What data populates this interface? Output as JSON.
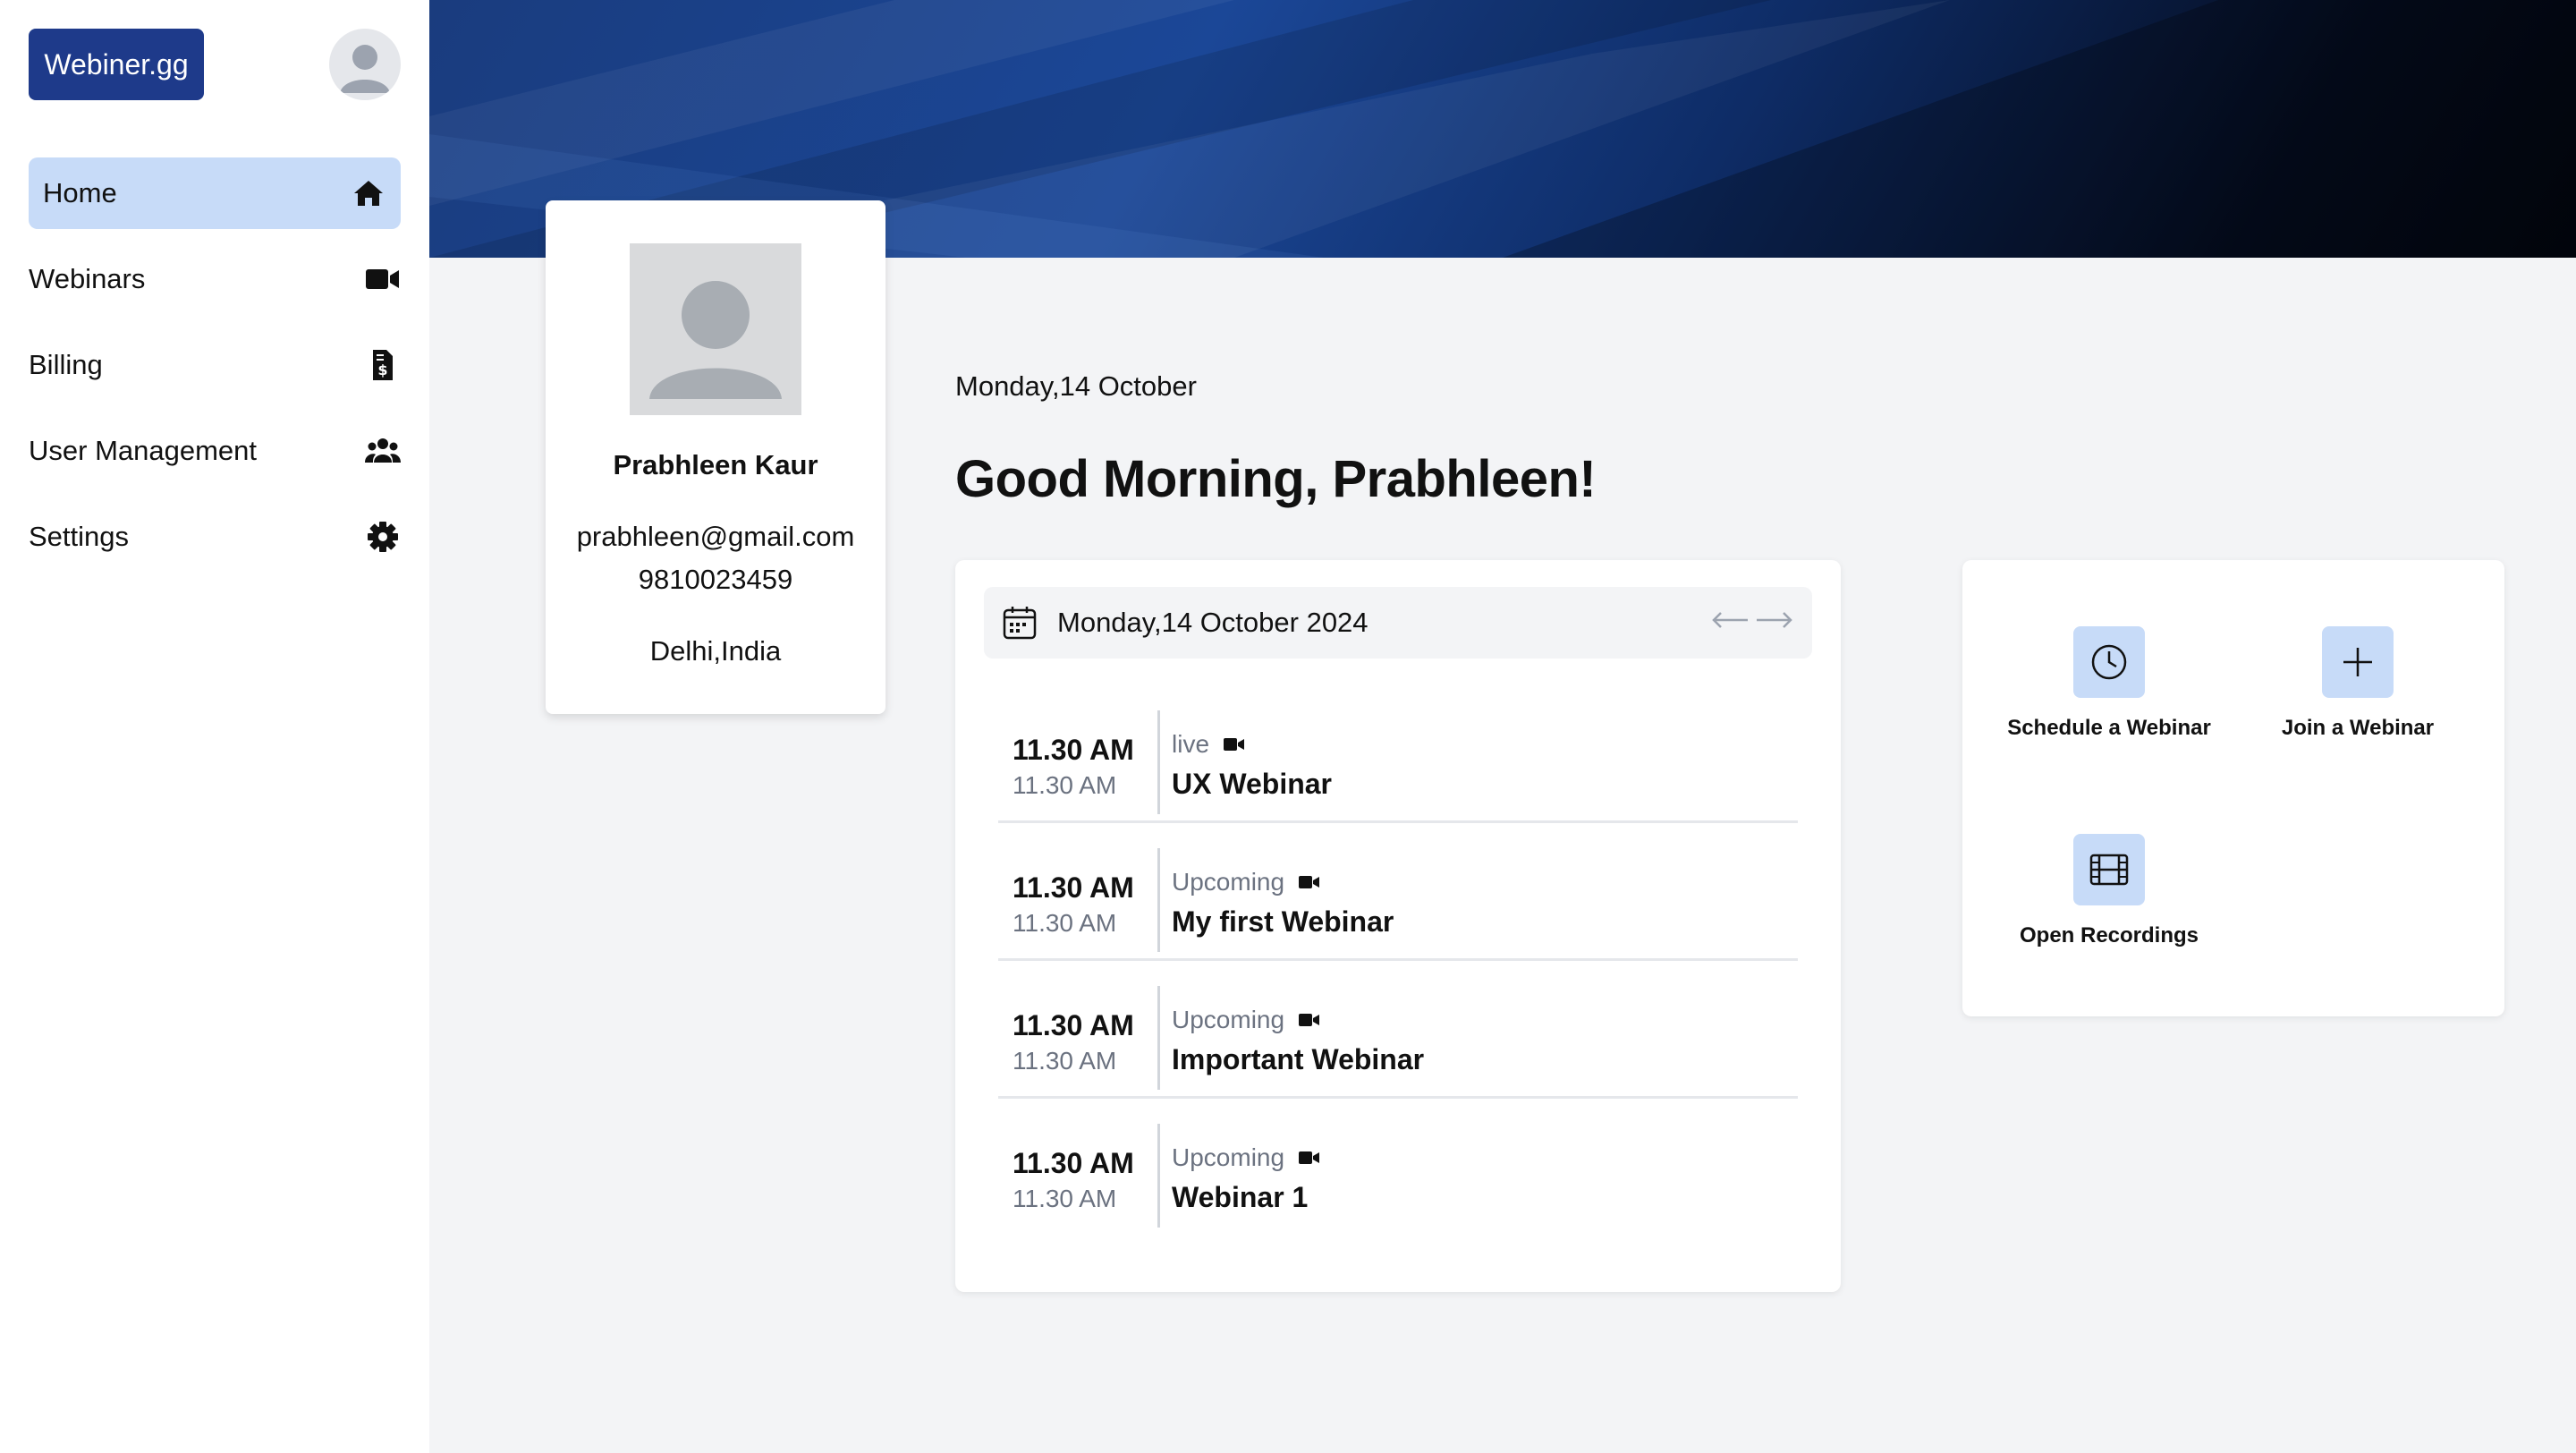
{
  "sidebar": {
    "logo": "Webiner.gg",
    "items": [
      {
        "label": "Home",
        "icon": "home-icon",
        "active": true
      },
      {
        "label": "Webinars",
        "icon": "video-camera-icon"
      },
      {
        "label": "Billing",
        "icon": "invoice-dollar-icon"
      },
      {
        "label": "User Management",
        "icon": "users-icon"
      },
      {
        "label": "Settings",
        "icon": "gear-icon"
      }
    ]
  },
  "profile": {
    "name": "Prabhleen Kaur",
    "email": "prabhleen@gmail.com",
    "phone": "9810023459",
    "location": "Delhi,India"
  },
  "greeting": {
    "date": "Monday,14 October",
    "message": "Good Morning, Prabhleen!"
  },
  "schedule": {
    "header_date": "Monday,14 October 2024",
    "items": [
      {
        "start": "11.30 AM",
        "end": "11.30 AM",
        "status": "live",
        "title": "UX Webinar"
      },
      {
        "start": "11.30 AM",
        "end": "11.30 AM",
        "status": "Upcoming",
        "title": "My first Webinar"
      },
      {
        "start": "11.30 AM",
        "end": "11.30 AM",
        "status": "Upcoming",
        "title": "Important Webinar"
      },
      {
        "start": "11.30 AM",
        "end": "11.30 AM",
        "status": "Upcoming",
        "title": "Webinar 1"
      }
    ]
  },
  "actions": {
    "schedule": "Schedule a Webinar",
    "join": "Join a Webinar",
    "recordings": "Open Recordings"
  },
  "colors": {
    "brand": "#1e3a8a",
    "accent_light": "#c7dbf8",
    "background": "#f3f4f6"
  }
}
